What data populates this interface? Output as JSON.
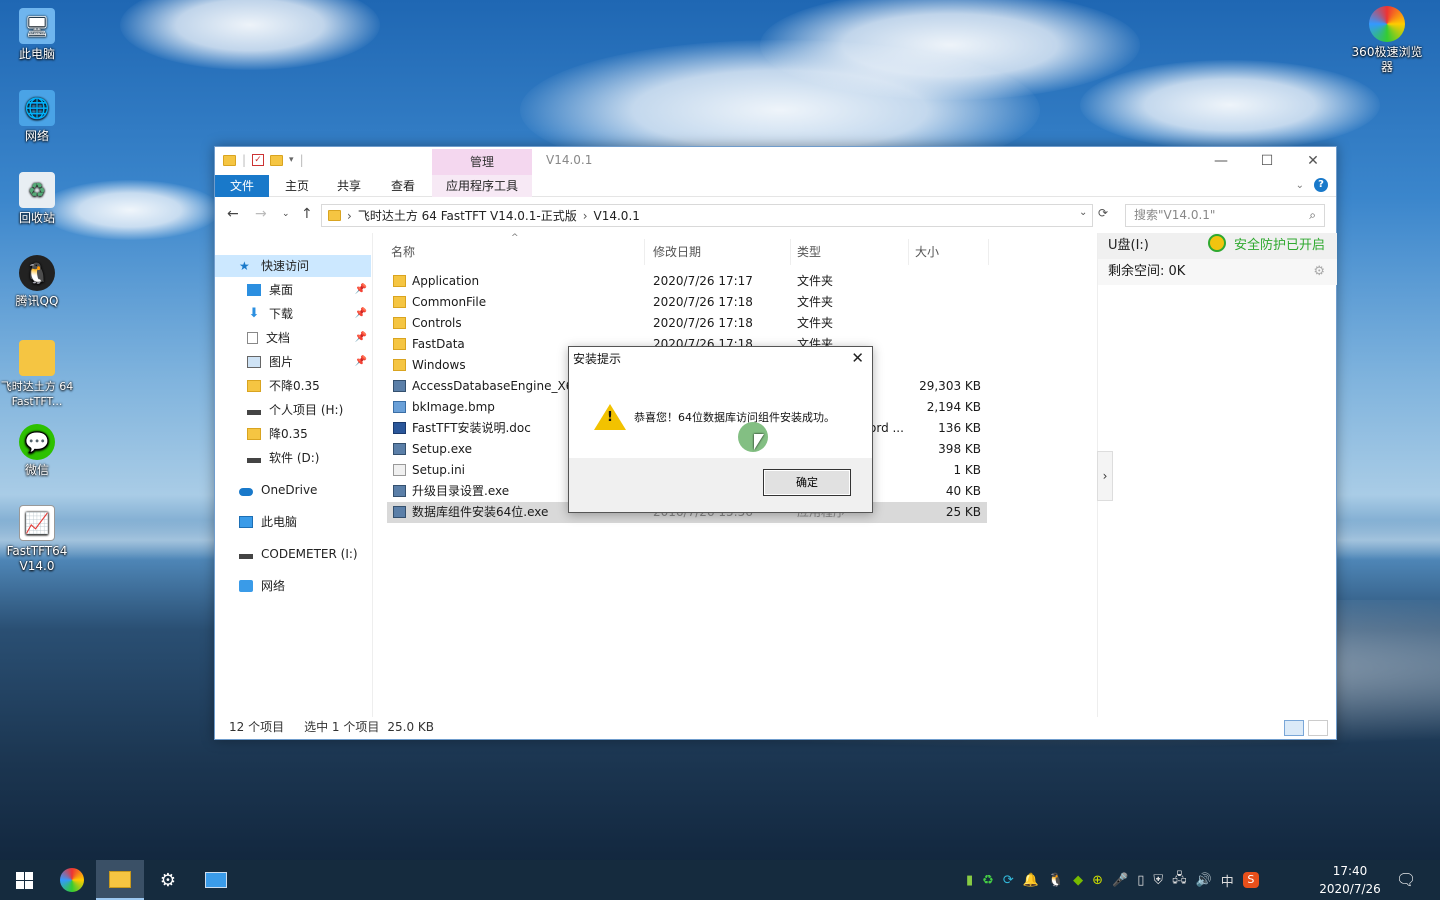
{
  "desktop": {
    "icons": [
      {
        "label": "此电脑",
        "icon": "computer-icon"
      },
      {
        "label": "网络",
        "icon": "network-icon"
      },
      {
        "label": "回收站",
        "icon": "recycle-bin-icon"
      },
      {
        "label": "腾讯QQ",
        "icon": "qq-penguin-icon"
      },
      {
        "label": "飞时达土方 64 FastTFT...",
        "icon": "folder-icon"
      },
      {
        "label": "微信",
        "icon": "wechat-icon"
      },
      {
        "label": "FastTFT64 V14.0",
        "icon": "fasttft-app-icon"
      },
      {
        "label": "360极速浏览器",
        "icon": "browser-360-icon"
      }
    ]
  },
  "explorer": {
    "manage_tab": "管理",
    "window_title": "V14.0.1",
    "ribbon_tabs": [
      "文件",
      "主页",
      "共享",
      "查看",
      "应用程序工具"
    ],
    "address": {
      "segments": [
        "飞时达土方 64 FastTFT V14.0.1-正式版",
        "V14.0.1"
      ]
    },
    "search_placeholder": "搜索\"V14.0.1\"",
    "nav": [
      {
        "label": "快速访问",
        "pinned": false
      },
      {
        "label": "桌面",
        "pinned": true
      },
      {
        "label": "下载",
        "pinned": true
      },
      {
        "label": "文档",
        "pinned": true
      },
      {
        "label": "图片",
        "pinned": true
      },
      {
        "label": "不降0.35",
        "pinned": false
      },
      {
        "label": "个人项目 (H:)",
        "pinned": false
      },
      {
        "label": "降0.35",
        "pinned": false
      },
      {
        "label": "软件 (D:)",
        "pinned": false
      },
      {
        "label": "OneDrive",
        "pinned": false
      },
      {
        "label": "此电脑",
        "pinned": false
      },
      {
        "label": "CODEMETER (I:)",
        "pinned": false
      },
      {
        "label": "网络",
        "pinned": false
      }
    ],
    "columns": [
      "名称",
      "修改日期",
      "类型",
      "大小"
    ],
    "files": [
      {
        "name": "Application",
        "date": "2020/7/26 17:17",
        "type": "文件夹",
        "size": "",
        "kind": "folder"
      },
      {
        "name": "CommonFile",
        "date": "2020/7/26 17:18",
        "type": "文件夹",
        "size": "",
        "kind": "folder"
      },
      {
        "name": "Controls",
        "date": "2020/7/26 17:18",
        "type": "文件夹",
        "size": "",
        "kind": "folder"
      },
      {
        "name": "FastData",
        "date": "2020/7/26 17:18",
        "type": "文件夹",
        "size": "",
        "kind": "folder"
      },
      {
        "name": "Windows",
        "date": "",
        "type": "",
        "size": "",
        "kind": "folder"
      },
      {
        "name": "AccessDatabaseEngine_X64",
        "date": "",
        "type": "",
        "size": "29,303 KB",
        "kind": "exe"
      },
      {
        "name": "bkImage.bmp",
        "date": "",
        "type": "",
        "size": "2,194 KB",
        "kind": "bmp"
      },
      {
        "name": "FastTFT安装说明.doc",
        "date": "",
        "type": "ord ...",
        "size": "136 KB",
        "kind": "doc"
      },
      {
        "name": "Setup.exe",
        "date": "",
        "type": "",
        "size": "398 KB",
        "kind": "exe"
      },
      {
        "name": "Setup.ini",
        "date": "",
        "type": "",
        "size": "1 KB",
        "kind": "ini"
      },
      {
        "name": "升级目录设置.exe",
        "date": "",
        "type": "",
        "size": "40 KB",
        "kind": "exe"
      },
      {
        "name": "数据库组件安装64位.exe",
        "date": "2016/7/26 15:56",
        "type": "应用程序",
        "size": "25 KB",
        "kind": "exe",
        "selected": true
      }
    ],
    "right_pane": {
      "drive": "U盘(I:)",
      "protection": "安全防护已开启",
      "free_space": "剩余空间: 0K"
    },
    "status": {
      "count": "12 个项目",
      "selection": "选中 1 个项目",
      "size": "25.0 KB"
    }
  },
  "dialog": {
    "title": "安装提示",
    "message": "恭喜您！64位数据库访问组件安装成功。",
    "ok_label": "确定"
  },
  "taskbar": {
    "ime": "中",
    "time": "17:40",
    "date": "2020/7/26"
  }
}
